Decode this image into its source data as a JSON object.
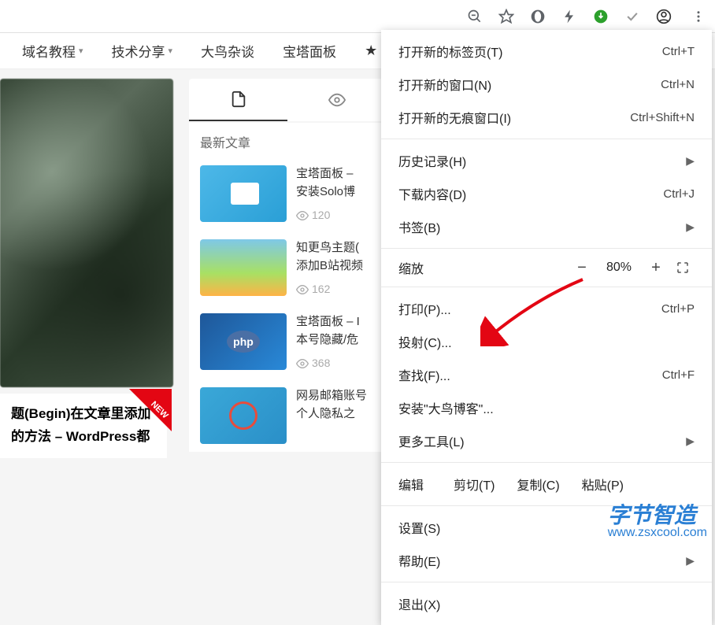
{
  "toolbar": {
    "zoom_out": "zoom-out",
    "star": "star",
    "opera": "opera",
    "lightning": "lightning",
    "globe": "download-manager",
    "check": "check",
    "profile": "profile",
    "menu": "menu"
  },
  "nav": {
    "items": [
      {
        "label": "域名教程",
        "has_caret": true
      },
      {
        "label": "技术分享",
        "has_caret": true
      },
      {
        "label": "大鸟杂谈",
        "has_caret": false
      },
      {
        "label": "宝塔面板",
        "has_caret": false
      }
    ]
  },
  "hero": {
    "caption_line1": "题(Begin)在文章里添加",
    "caption_line2": "的方法 – WordPress都",
    "badge": "NEW"
  },
  "sidebar": {
    "section_title": "最新文章",
    "articles": [
      {
        "title_line1": "宝塔面板 –",
        "title_line2": "安装Solo博",
        "views": "120"
      },
      {
        "title_line1": "知更鸟主题(",
        "title_line2": "添加B站视频",
        "views": "162"
      },
      {
        "title_line1": "宝塔面板 – I",
        "title_line2": "本号隐藏/危",
        "views": "368"
      },
      {
        "title_line1": "网易邮箱账号",
        "title_line2": "个人隐私之",
        "views": ""
      }
    ]
  },
  "menu": {
    "new_tab": {
      "label": "打开新的标签页(T)",
      "shortcut": "Ctrl+T"
    },
    "new_window": {
      "label": "打开新的窗口(N)",
      "shortcut": "Ctrl+N"
    },
    "incognito": {
      "label": "打开新的无痕窗口(I)",
      "shortcut": "Ctrl+Shift+N"
    },
    "history": {
      "label": "历史记录(H)"
    },
    "downloads": {
      "label": "下载内容(D)",
      "shortcut": "Ctrl+J"
    },
    "bookmarks": {
      "label": "书签(B)"
    },
    "zoom": {
      "label": "缩放",
      "value": "80%",
      "minus": "−",
      "plus": "+"
    },
    "print": {
      "label": "打印(P)...",
      "shortcut": "Ctrl+P"
    },
    "cast": {
      "label": "投射(C)..."
    },
    "find": {
      "label": "查找(F)...",
      "shortcut": "Ctrl+F"
    },
    "install": {
      "label": "安装\"大鸟博客\"..."
    },
    "more_tools": {
      "label": "更多工具(L)"
    },
    "edit": {
      "label": "编辑",
      "cut": "剪切(T)",
      "copy": "复制(C)",
      "paste": "粘贴(P)"
    },
    "settings": {
      "label": "设置(S)"
    },
    "help": {
      "label": "帮助(E)"
    },
    "exit": {
      "label": "退出(X)"
    }
  },
  "watermark": {
    "brand": "字节智造",
    "url": "www.zsxcool.com"
  }
}
